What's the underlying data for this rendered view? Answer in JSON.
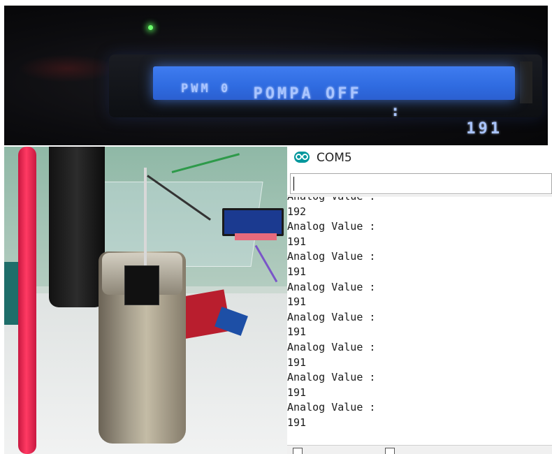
{
  "lcd": {
    "line1_label": "POMPA OFF",
    "line1_sep": ":",
    "line1_value": "191",
    "line2": "PWM 0"
  },
  "serial_monitor": {
    "title": "COM5",
    "input_value": "",
    "output_lines": [
      "Analog Value :",
      "192",
      "Analog Value :",
      "191",
      "Analog Value :",
      "191",
      "Analog Value :",
      "191",
      "Analog Value :",
      "191",
      "Analog Value :",
      "191",
      "Analog Value :",
      "191",
      "Analog Value :",
      "191"
    ]
  },
  "colors": {
    "lcd_backlight": "#3f7cf0",
    "lcd_text": "#a9c4ff",
    "arduino_teal": "#00979c"
  },
  "icons": {
    "serial_logo": "arduino-logo-icon",
    "status_led": "green-led-icon"
  }
}
